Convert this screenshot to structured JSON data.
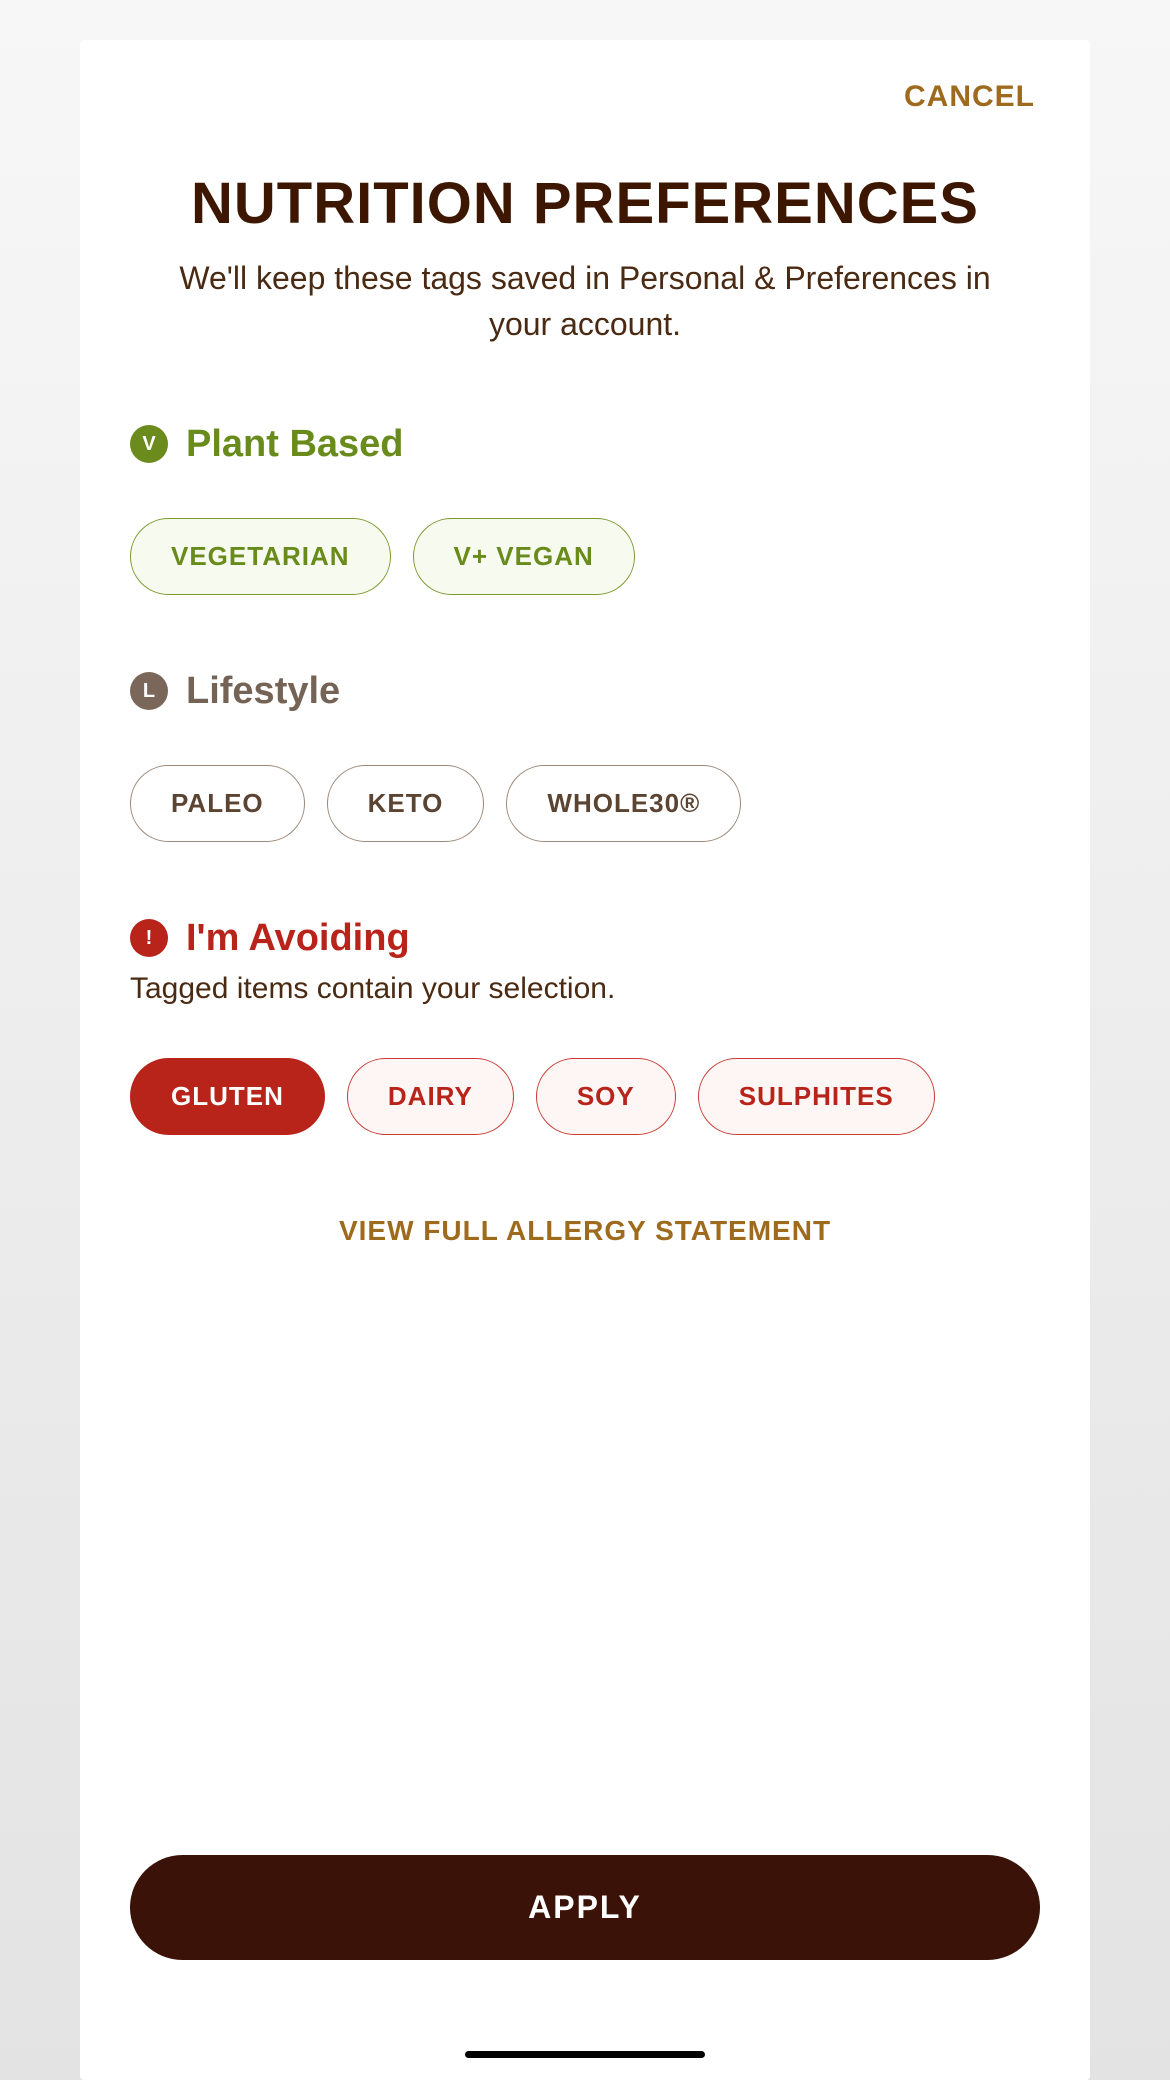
{
  "header": {
    "cancel_label": "CANCEL",
    "title": "NUTRITION PREFERENCES",
    "subtitle": "We'll keep these tags saved in Personal & Preferences in your account."
  },
  "sections": {
    "plant_based": {
      "badge_letter": "V",
      "title": "Plant Based",
      "chips": [
        {
          "label": "VEGETARIAN",
          "selected": false
        },
        {
          "label": "V+ VEGAN",
          "selected": false
        }
      ]
    },
    "lifestyle": {
      "badge_letter": "L",
      "title": "Lifestyle",
      "chips": [
        {
          "label": "PALEO",
          "selected": false
        },
        {
          "label": "KETO",
          "selected": false
        },
        {
          "label": "WHOLE30®",
          "selected": false
        }
      ]
    },
    "avoiding": {
      "badge_letter": "!",
      "title": "I'm Avoiding",
      "note": "Tagged items contain your selection.",
      "chips": [
        {
          "label": "GLUTEN",
          "selected": true
        },
        {
          "label": "DAIRY",
          "selected": false
        },
        {
          "label": "SOY",
          "selected": false
        },
        {
          "label": "SULPHITES",
          "selected": false
        }
      ]
    }
  },
  "allergy_link_label": "VIEW FULL ALLERGY STATEMENT",
  "apply_label": "APPLY"
}
